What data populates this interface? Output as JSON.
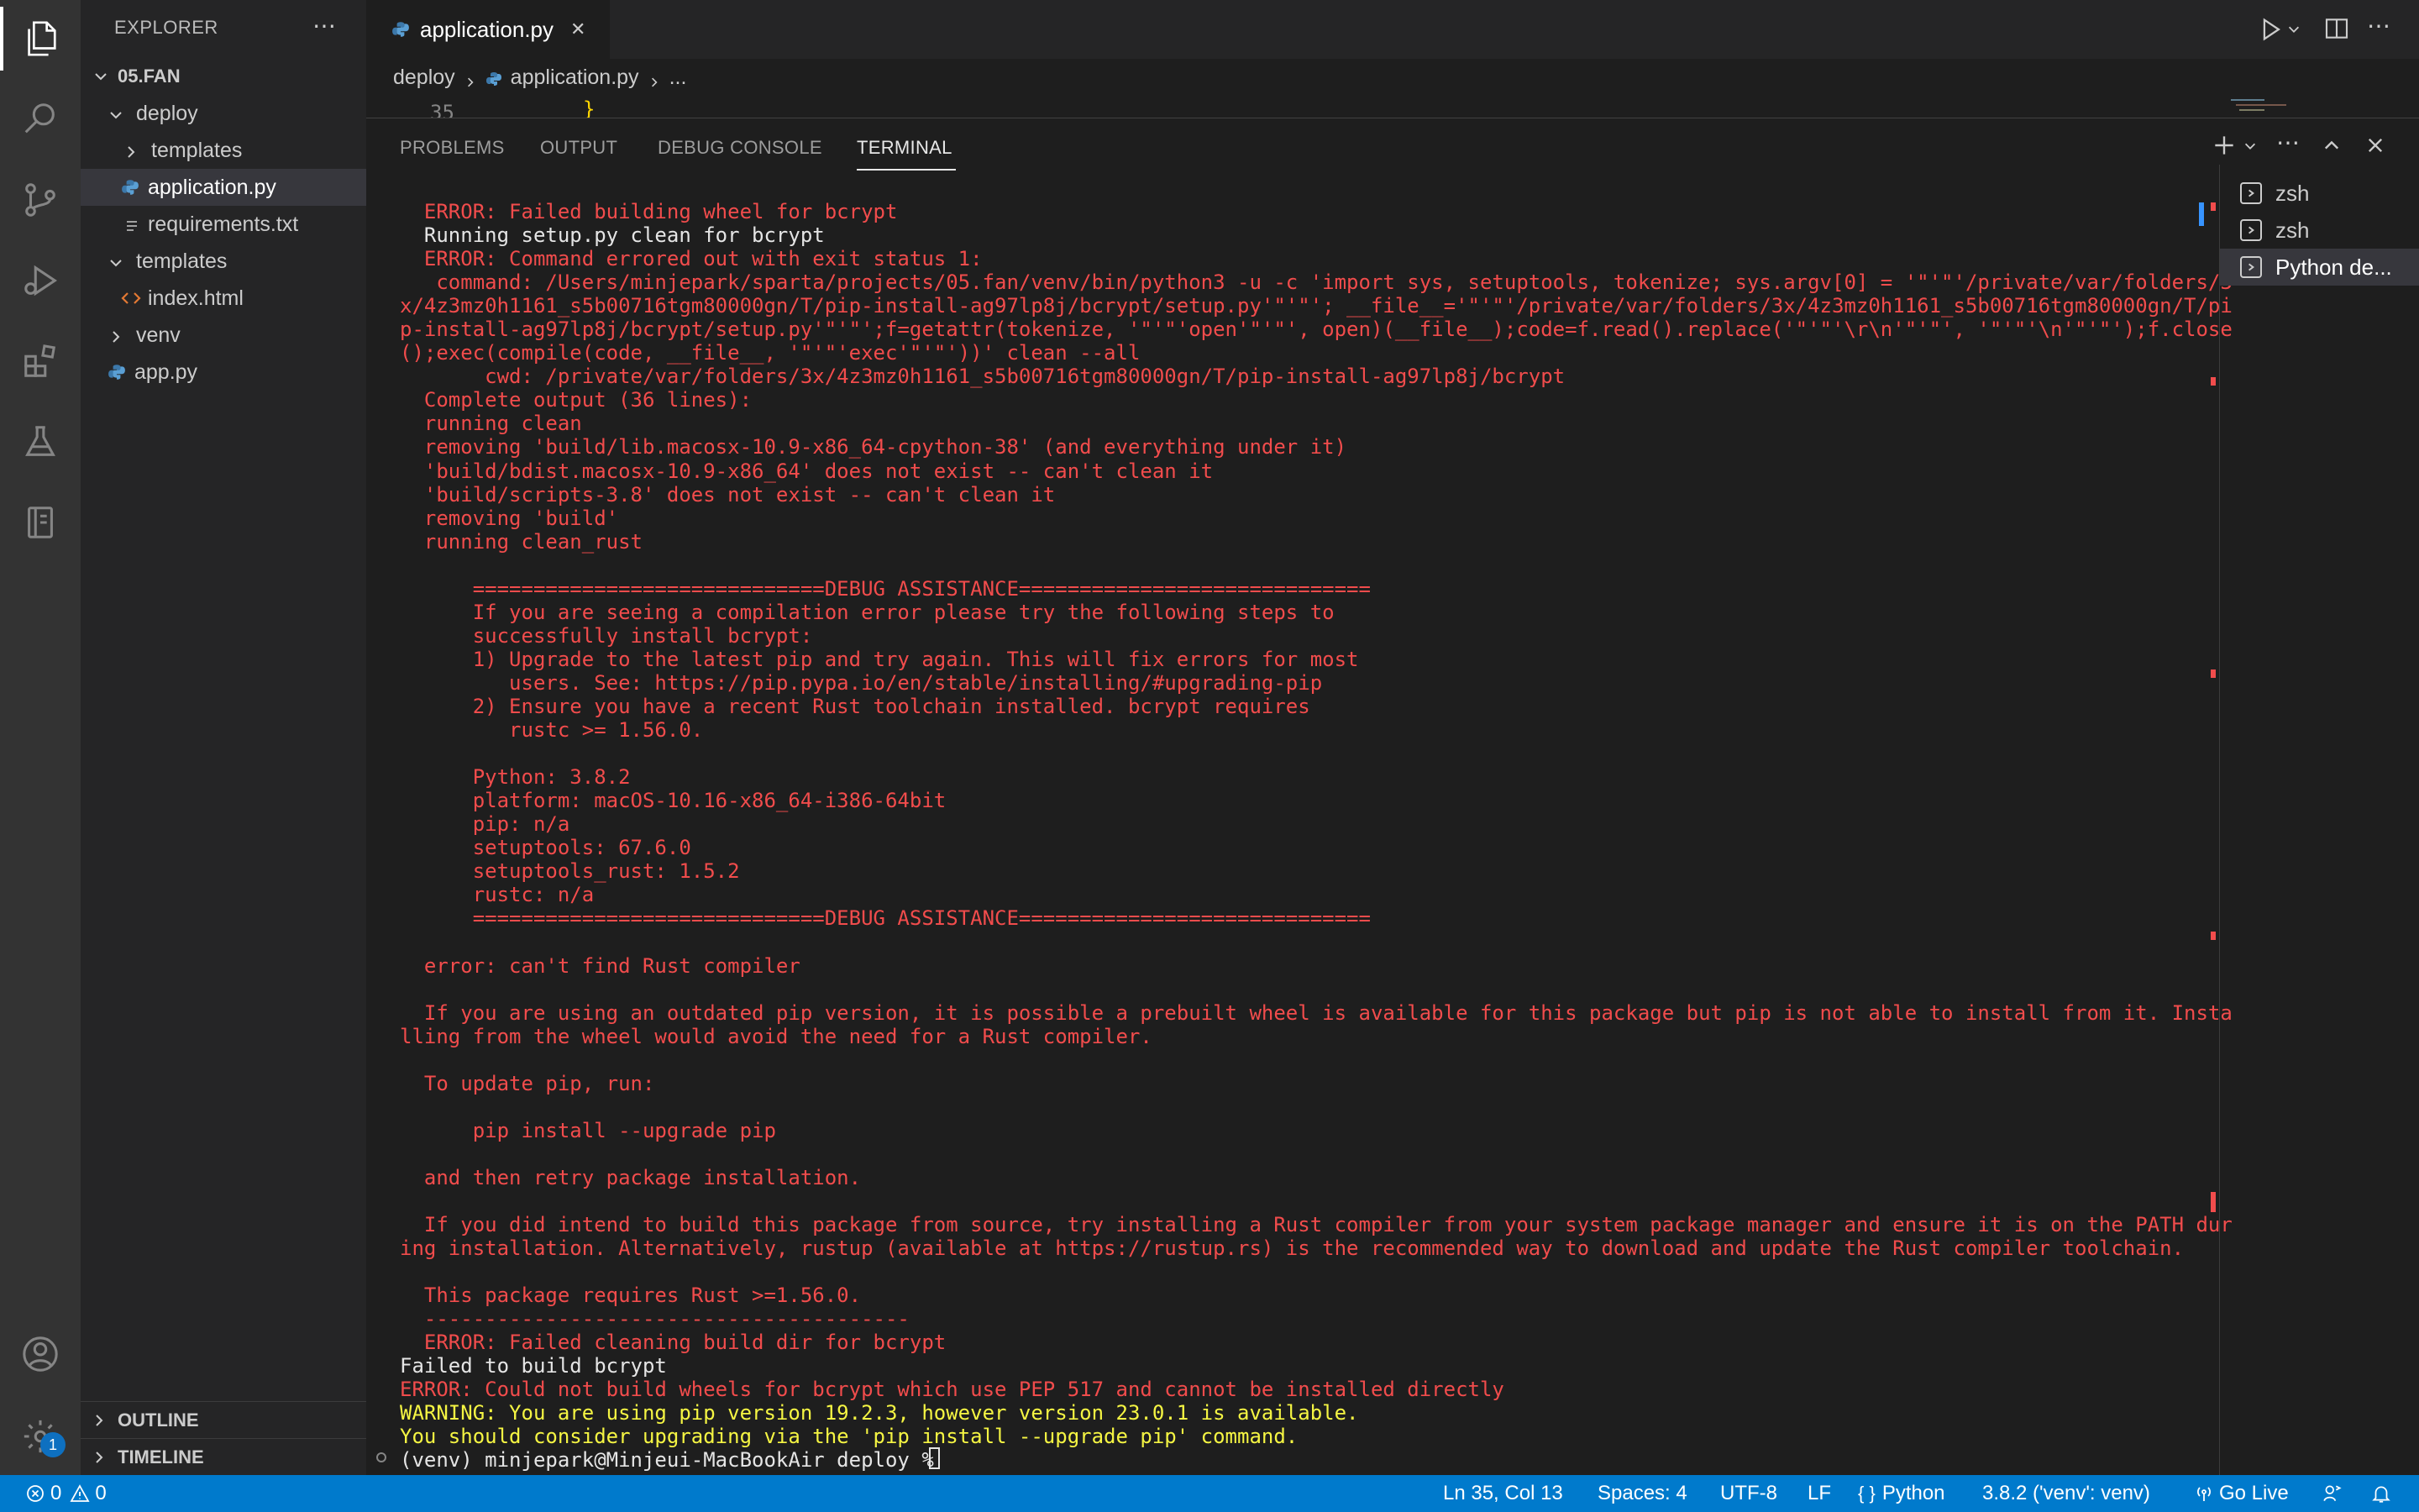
{
  "explorer": {
    "title": "EXPLORER",
    "more": "⋯",
    "root": "05.FAN",
    "items": [
      {
        "label": "deploy",
        "type": "folder",
        "expanded": true
      },
      {
        "label": "templates",
        "type": "folder",
        "expanded": false
      },
      {
        "label": "application.py",
        "type": "python-file"
      },
      {
        "label": "requirements.txt",
        "type": "text-file"
      },
      {
        "label": "templates",
        "type": "folder",
        "expanded": true
      },
      {
        "label": "index.html",
        "type": "html-file"
      },
      {
        "label": "venv",
        "type": "folder",
        "expanded": false
      },
      {
        "label": "app.py",
        "type": "python-file"
      }
    ],
    "outline": "OUTLINE",
    "timeline": "TIMELINE"
  },
  "activity": {
    "settings_badge": "1"
  },
  "tab": {
    "label": "application.py",
    "close": "✕"
  },
  "breadcrumb": {
    "part1": "deploy",
    "part2": "application.py",
    "part3": "..."
  },
  "editor_peek": {
    "line_number": "35",
    "code": "}"
  },
  "panel": {
    "tabs": [
      "PROBLEMS",
      "OUTPUT",
      "DEBUG CONSOLE",
      "TERMINAL"
    ],
    "active_tab": "TERMINAL"
  },
  "terminal_lines": [
    {
      "c": "red",
      "t": "  ERROR: Failed building wheel for bcrypt"
    },
    {
      "c": "white",
      "t": "  Running setup.py clean for bcrypt"
    },
    {
      "c": "red",
      "t": "  ERROR: Command errored out with exit status 1:"
    },
    {
      "c": "red",
      "t": "   command: /Users/minjepark/sparta/projects/05.fan/venv/bin/python3 -u -c 'import sys, setuptools, tokenize; sys.argv[0] = '\"'\"'/private/var/folders/3"
    },
    {
      "c": "red",
      "t": "x/4z3mz0h1161_s5b00716tgm80000gn/T/pip-install-ag97lp8j/bcrypt/setup.py'\"'\"'; __file__='\"'\"'/private/var/folders/3x/4z3mz0h1161_s5b00716tgm80000gn/T/pi"
    },
    {
      "c": "red",
      "t": "p-install-ag97lp8j/bcrypt/setup.py'\"'\"';f=getattr(tokenize, '\"'\"'open'\"'\"', open)(__file__);code=f.read().replace('\"'\"'\\r\\n'\"'\"', '\"'\"'\\n'\"'\"');f.close"
    },
    {
      "c": "red",
      "t": "();exec(compile(code, __file__, '\"'\"'exec'\"'\"'))' clean --all"
    },
    {
      "c": "red",
      "t": "       cwd: /private/var/folders/3x/4z3mz0h1161_s5b00716tgm80000gn/T/pip-install-ag97lp8j/bcrypt"
    },
    {
      "c": "red",
      "t": "  Complete output (36 lines):"
    },
    {
      "c": "red",
      "t": "  running clean"
    },
    {
      "c": "red",
      "t": "  removing 'build/lib.macosx-10.9-x86_64-cpython-38' (and everything under it)"
    },
    {
      "c": "red",
      "t": "  'build/bdist.macosx-10.9-x86_64' does not exist -- can't clean it"
    },
    {
      "c": "red",
      "t": "  'build/scripts-3.8' does not exist -- can't clean it"
    },
    {
      "c": "red",
      "t": "  removing 'build'"
    },
    {
      "c": "red",
      "t": "  running clean_rust"
    },
    {
      "c": "red",
      "t": ""
    },
    {
      "c": "red",
      "t": "      =============================DEBUG ASSISTANCE============================="
    },
    {
      "c": "red",
      "t": "      If you are seeing a compilation error please try the following steps to"
    },
    {
      "c": "red",
      "t": "      successfully install bcrypt:"
    },
    {
      "c": "red",
      "t": "      1) Upgrade to the latest pip and try again. This will fix errors for most"
    },
    {
      "c": "red",
      "t": "         users. See: https://pip.pypa.io/en/stable/installing/#upgrading-pip"
    },
    {
      "c": "red",
      "t": "      2) Ensure you have a recent Rust toolchain installed. bcrypt requires"
    },
    {
      "c": "red",
      "t": "         rustc >= 1.56.0."
    },
    {
      "c": "red",
      "t": ""
    },
    {
      "c": "red",
      "t": "      Python: 3.8.2"
    },
    {
      "c": "red",
      "t": "      platform: macOS-10.16-x86_64-i386-64bit"
    },
    {
      "c": "red",
      "t": "      pip: n/a"
    },
    {
      "c": "red",
      "t": "      setuptools: 67.6.0"
    },
    {
      "c": "red",
      "t": "      setuptools_rust: 1.5.2"
    },
    {
      "c": "red",
      "t": "      rustc: n/a"
    },
    {
      "c": "red",
      "t": "      =============================DEBUG ASSISTANCE============================="
    },
    {
      "c": "red",
      "t": ""
    },
    {
      "c": "red",
      "t": "  error: can't find Rust compiler"
    },
    {
      "c": "red",
      "t": ""
    },
    {
      "c": "red",
      "t": "  If you are using an outdated pip version, it is possible a prebuilt wheel is available for this package but pip is not able to install from it. Insta"
    },
    {
      "c": "red",
      "t": "lling from the wheel would avoid the need for a Rust compiler."
    },
    {
      "c": "red",
      "t": ""
    },
    {
      "c": "red",
      "t": "  To update pip, run:"
    },
    {
      "c": "red",
      "t": ""
    },
    {
      "c": "red",
      "t": "      pip install --upgrade pip"
    },
    {
      "c": "red",
      "t": ""
    },
    {
      "c": "red",
      "t": "  and then retry package installation."
    },
    {
      "c": "red",
      "t": ""
    },
    {
      "c": "red",
      "t": "  If you did intend to build this package from source, try installing a Rust compiler from your system package manager and ensure it is on the PATH dur"
    },
    {
      "c": "red",
      "t": "ing installation. Alternatively, rustup (available at https://rustup.rs) is the recommended way to download and update the Rust compiler toolchain."
    },
    {
      "c": "red",
      "t": ""
    },
    {
      "c": "red",
      "t": "  This package requires Rust >=1.56.0."
    },
    {
      "c": "red",
      "t": "  ----------------------------------------"
    },
    {
      "c": "red",
      "t": "  ERROR: Failed cleaning build dir for bcrypt"
    },
    {
      "c": "white",
      "t": "Failed to build bcrypt"
    },
    {
      "c": "red",
      "t": "ERROR: Could not build wheels for bcrypt which use PEP 517 and cannot be installed directly"
    },
    {
      "c": "yellow",
      "t": "WARNING: You are using pip version 19.2.3, however version 23.0.1 is available."
    },
    {
      "c": "yellow",
      "t": "You should consider upgrading via the 'pip install --upgrade pip' command."
    },
    {
      "c": "white",
      "t": "(venv) minjepark@Minjeui-MacBookAir deploy % "
    }
  ],
  "terminal_list": [
    {
      "label": "zsh"
    },
    {
      "label": "zsh"
    },
    {
      "label": "Python de..."
    }
  ],
  "statusbar": {
    "errors": "0",
    "warnings": "0",
    "position": "Ln 35, Col 13",
    "spaces": "Spaces: 4",
    "encoding": "UTF-8",
    "eol": "LF",
    "language": "Python",
    "interpreter": "3.8.2 ('venv': venv)",
    "golive": "Go Live"
  },
  "colors": {
    "accent": "#007acc",
    "terminal_red": "#f14c4c",
    "terminal_yellow": "#f5f543",
    "terminal_white": "#e5e5e5"
  }
}
